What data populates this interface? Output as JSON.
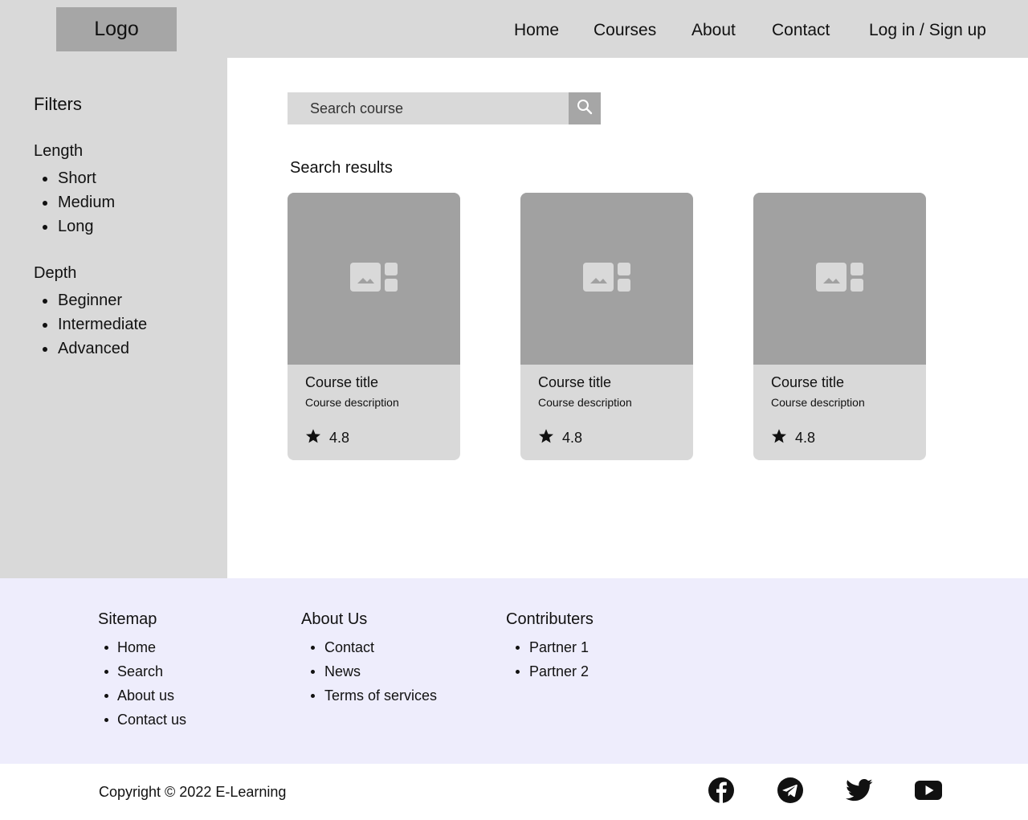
{
  "header": {
    "logo": "Logo",
    "nav": [
      "Home",
      "Courses",
      "About",
      "Contact",
      "Log in / Sign up"
    ]
  },
  "sidebar": {
    "title": "Filters",
    "groups": [
      {
        "title": "Length",
        "items": [
          "Short",
          "Medium",
          "Long"
        ]
      },
      {
        "title": "Depth",
        "items": [
          "Beginner",
          "Intermediate",
          "Advanced"
        ]
      }
    ]
  },
  "search": {
    "placeholder": "Search course"
  },
  "results": {
    "title": "Search results",
    "cards": [
      {
        "title": "Course title",
        "description": "Course description",
        "rating": "4.8"
      },
      {
        "title": "Course title",
        "description": "Course description",
        "rating": "4.8"
      },
      {
        "title": "Course title",
        "description": "Course description",
        "rating": "4.8"
      }
    ]
  },
  "footer": {
    "columns": [
      {
        "title": "Sitemap",
        "items": [
          "Home",
          "Search",
          "About us",
          "Contact us"
        ]
      },
      {
        "title": "About Us",
        "items": [
          "Contact",
          "News",
          "Terms of services"
        ]
      },
      {
        "title": "Contributers",
        "items": [
          "Partner 1",
          "Partner 2"
        ]
      }
    ],
    "copyright": "Copyright © 2022 E-Learning",
    "social_icons": [
      "facebook-icon",
      "telegram-icon",
      "twitter-icon",
      "youtube-icon"
    ]
  },
  "colors": {
    "header_bg": "#d9d9d9",
    "logo_bg": "#a6a6a6",
    "card_image_bg": "#a1a1a1",
    "footer_bg": "#eeedfc"
  }
}
